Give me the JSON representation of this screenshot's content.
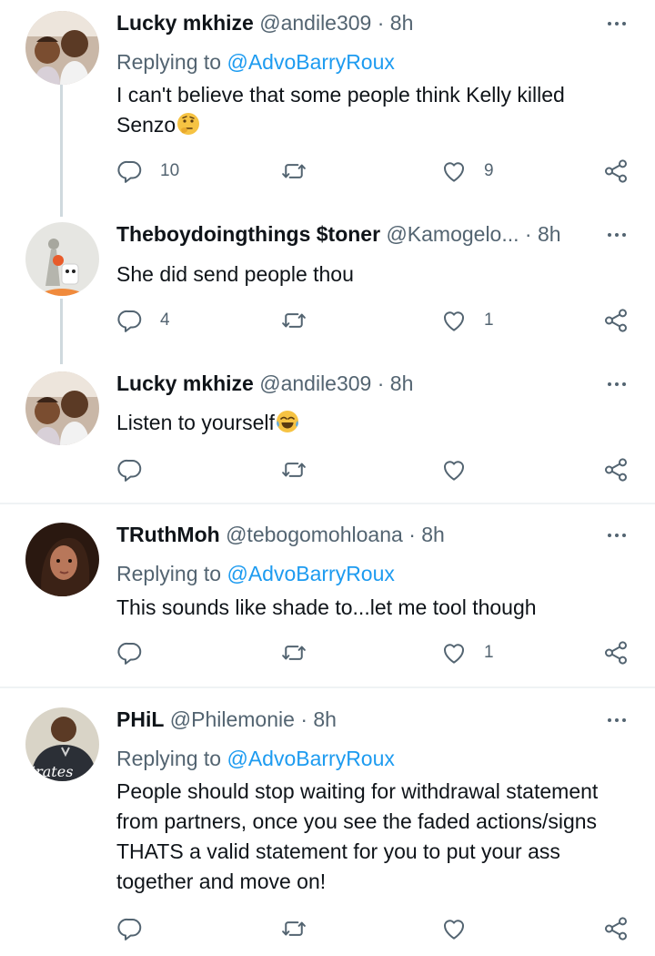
{
  "tweets": [
    {
      "name": "Lucky mkhize",
      "handle": "@andile309",
      "sep": "·",
      "time": "8h",
      "replying_prefix": "Replying to ",
      "replying_to": "@AdvoBarryRoux",
      "text": "I can't believe that some people think Kelly killed Senzo",
      "emoji": "thinking-face",
      "replies": "10",
      "retweets": "",
      "likes": "9"
    },
    {
      "name": "Theboydoingthings $toner",
      "handle": "@Kamogelo...",
      "sep": "·",
      "time": "8h",
      "text": "She did send people thou",
      "replies": "4",
      "retweets": "",
      "likes": "1"
    },
    {
      "name": "Lucky mkhize",
      "handle": "@andile309",
      "sep": "·",
      "time": "8h",
      "text": "Listen to yourself",
      "emoji": "tears-of-joy",
      "replies": "",
      "retweets": "",
      "likes": ""
    },
    {
      "name": "TRuthMoh",
      "handle": "@tebogomohloana",
      "sep": "·",
      "time": "8h",
      "replying_prefix": "Replying to ",
      "replying_to": "@AdvoBarryRoux",
      "text": "This sounds like shade to...let me tool though",
      "replies": "",
      "retweets": "",
      "likes": "1"
    },
    {
      "name": "PHiL",
      "handle": "@Philemonie",
      "sep": "·",
      "time": "8h",
      "replying_prefix": "Replying to ",
      "replying_to": "@AdvoBarryRoux",
      "text": "People should stop waiting for withdrawal statement from partners, once you see the faded actions/signs THATS a valid statement for you to put your ass together and move on!",
      "avatar_text": "irates",
      "replies": "",
      "retweets": "",
      "likes": ""
    }
  ],
  "colors": {
    "text": "#0f1419",
    "muted": "#536471",
    "link": "#1d9bf0",
    "thread_line": "#cfd9de",
    "divider": "#eff3f4"
  },
  "icons": [
    "reply-icon",
    "retweet-icon",
    "like-icon",
    "share-icon",
    "more-icon"
  ]
}
